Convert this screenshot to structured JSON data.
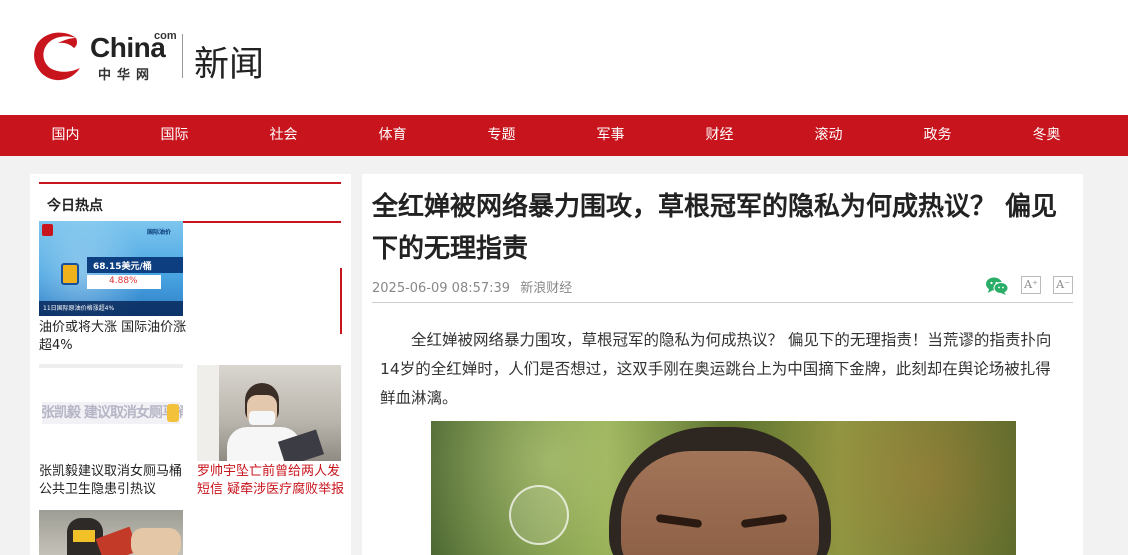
{
  "header": {
    "logo_brand": "China",
    "logo_com": "com",
    "logo_zh": "中华网",
    "section": "新闻"
  },
  "nav": {
    "items": [
      "国内",
      "国际",
      "社会",
      "体育",
      "专题",
      "军事",
      "财经",
      "滚动",
      "政务",
      "冬奥"
    ]
  },
  "sidebar": {
    "title": "今日热点",
    "items": [
      {
        "caption": "油价或将大涨 国际油价涨超4%",
        "image_overlay": {
          "tag": "国际油价",
          "price": "68.15美元/桶",
          "change": "4.88%",
          "footer": "11日国际原油价格涨超4%"
        }
      },
      {
        "caption": "张凯毅建议取消女厕马桶 公共卫生隐患引热议",
        "image_overlay": {
          "text": "张凯毅 建议取消女厕马桶"
        }
      },
      {
        "caption": "罗帅宇坠亡前曾给两人发短信 疑牵涉医疗腐败举报"
      },
      {
        "caption": ""
      }
    ]
  },
  "article": {
    "title": "全红婵被网络暴力围攻，草根冠军的隐私为何成热议？ 偏见下的无理指责",
    "datetime": "2025-06-09 08:57:39",
    "source": "新浪财经",
    "font_up": "A⁺",
    "font_down": "A⁻",
    "paragraph": "全红婵被网络暴力围攻，草根冠军的隐私为何成热议？ 偏见下的无理指责！当荒谬的指责扑向14岁的全红婵时，人们是否想过，这双手刚在奥运跳台上为中国摘下金牌，此刻却在舆论场被扎得鲜血淋漓。"
  },
  "colors": {
    "brand_red": "#c8151d",
    "share_green": "#2aae67",
    "caption_red": "#c8151d"
  },
  "icons": {
    "share": "wechat-icon"
  }
}
